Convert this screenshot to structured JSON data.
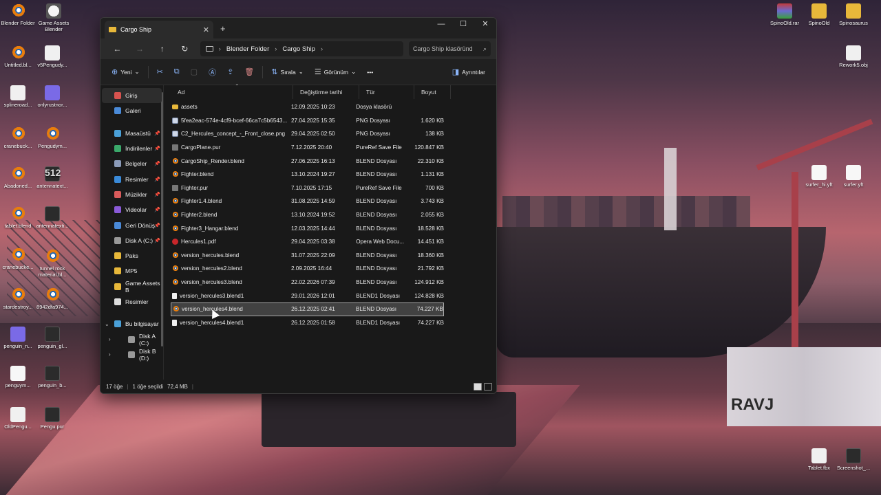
{
  "desktop": {
    "left_icons": [
      {
        "label": "Blender Folder",
        "icon": "blender-icon"
      },
      {
        "label": "Game Assets Blender",
        "icon": "game-icon"
      },
      {
        "label": "Untitled.bl...",
        "icon": "blender-icon"
      },
      {
        "label": "v5Pengudy...",
        "icon": "obj-icon"
      },
      {
        "label": "splineroad...",
        "icon": "obj-icon"
      },
      {
        "label": "onlyrustnor...",
        "icon": "purple-app-icon"
      },
      {
        "label": "cranebuck...",
        "icon": "blender-icon"
      },
      {
        "label": "Pengudym...",
        "icon": "blender-icon"
      },
      {
        "label": "Abadoned...",
        "icon": "blender-icon"
      },
      {
        "label": "antennatext...",
        "icon": "image-icon"
      },
      {
        "label": "tablet.blend",
        "icon": "blender-icon"
      },
      {
        "label": "antennatexti...",
        "icon": "image-icon"
      },
      {
        "label": "cranebucke...",
        "icon": "blender-icon"
      },
      {
        "label": "tunnel rock material.bl...",
        "icon": "blender-icon"
      },
      {
        "label": "stardestroy...",
        "icon": "blender-icon"
      },
      {
        "label": "8942dfa974...",
        "icon": "blender-icon"
      },
      {
        "label": "penguin_n...",
        "icon": "purple-app-icon"
      },
      {
        "label": "penguin_gl...",
        "icon": "image-icon"
      },
      {
        "label": "penguym...",
        "icon": "white-file-icon"
      },
      {
        "label": "penguin_b...",
        "icon": "image-icon"
      },
      {
        "label": "OldPengu...",
        "icon": "obj-icon"
      },
      {
        "label": "Pengu.pur",
        "icon": "pur-icon"
      }
    ],
    "right_icons": [
      {
        "label": "SpinoOld.rar",
        "icon": "rar-icon"
      },
      {
        "label": "SpinoOld",
        "icon": "folder-icon"
      },
      {
        "label": "Spinosaurus",
        "icon": "folder-icon"
      },
      {
        "label": "Rework5.obj",
        "icon": "obj-icon"
      },
      {
        "label": "surfer_hi.yft",
        "icon": "white-file-icon"
      },
      {
        "label": "surfer.yft",
        "icon": "white-file-icon"
      },
      {
        "label": "Tablet.fbx",
        "icon": "obj-icon"
      },
      {
        "label": "Screenshot_...",
        "icon": "image-icon"
      }
    ],
    "icon_512_label": "512"
  },
  "window": {
    "tab_title": "Cargo Ship",
    "tab_close": "✕",
    "new_tab": "+",
    "controls": {
      "minimize": "—",
      "maximize": "☐",
      "close": "✕"
    },
    "nav": {
      "back": "←",
      "forward": "→",
      "up": "↑",
      "refresh": "↻"
    },
    "breadcrumb": [
      "Blender Folder",
      "Cargo Ship"
    ],
    "crumb_sep": "›",
    "search_placeholder": "Cargo Ship klasöründ",
    "toolbar": {
      "new": "Yeni",
      "sort": "Sırala",
      "view": "Görünüm",
      "more": "•••",
      "details": "Ayrıntılar"
    },
    "sidebar": [
      {
        "label": "Giriş",
        "color": "#d8534f",
        "active": true
      },
      {
        "label": "Galeri",
        "color": "#4a8ad8"
      },
      {
        "gap": true
      },
      {
        "label": "Masaüstü",
        "color": "#4aa0d8",
        "pin": true
      },
      {
        "label": "İndirilenler",
        "color": "#3aa86a",
        "pin": true
      },
      {
        "label": "Belgeler",
        "color": "#8a9ab8",
        "pin": true
      },
      {
        "label": "Resimler",
        "color": "#3a8ad8",
        "pin": true
      },
      {
        "label": "Müzikler",
        "color": "#d85a5a",
        "pin": true
      },
      {
        "label": "Videolar",
        "color": "#8a5ad8",
        "pin": true
      },
      {
        "label": "Geri Dönüş",
        "color": "#4a8ad8",
        "pin": true
      },
      {
        "label": "Disk A (C:)",
        "color": "#999",
        "pin": true
      },
      {
        "label": "Paks",
        "color": "#e8b83a"
      },
      {
        "label": "MP5",
        "color": "#e8b83a"
      },
      {
        "label": "Game Assets B",
        "color": "#e8b83a"
      },
      {
        "label": "Resimler",
        "color": "#dddddd"
      },
      {
        "gap": true
      },
      {
        "label": "Bu bilgisayar",
        "color": "#4aa0d8",
        "chev": "⌄"
      },
      {
        "label": "Disk A (C:)",
        "color": "#999",
        "chev": "›",
        "indent": true
      },
      {
        "label": "Disk B (D:)",
        "color": "#999",
        "chev": "›",
        "indent": true
      }
    ],
    "columns": {
      "name": "Ad",
      "date": "Değiştirme tarihi",
      "type": "Tür",
      "size": "Boyut"
    },
    "files": [
      {
        "name": "assets",
        "date": "12.09.2025 10:23",
        "type": "Dosya klasörü",
        "size": "",
        "kind": "folder"
      },
      {
        "name": "5fea2eac-574e-4cf9-bcef-66ca7c5b6543...",
        "date": "27.04.2025 15:35",
        "type": "PNG Dosyası",
        "size": "1.620 KB",
        "kind": "png"
      },
      {
        "name": "C2_Hercules_concept_-_Front_close.png",
        "date": "29.04.2025 02:50",
        "type": "PNG Dosyası",
        "size": "138 KB",
        "kind": "png"
      },
      {
        "name": "CargoPlane.pur",
        "date": "7.12.2025 20:40",
        "type": "PureRef Save File",
        "size": "120.847 KB",
        "kind": "pur"
      },
      {
        "name": "CargoShip_Render.blend",
        "date": "27.06.2025 16:13",
        "type": "BLEND Dosyası",
        "size": "22.310 KB",
        "kind": "blend"
      },
      {
        "name": "Fighter.blend",
        "date": "13.10.2024 19:27",
        "type": "BLEND Dosyası",
        "size": "1.131 KB",
        "kind": "blend"
      },
      {
        "name": "Fighter.pur",
        "date": "7.10.2025 17:15",
        "type": "PureRef Save File",
        "size": "700 KB",
        "kind": "pur"
      },
      {
        "name": "Fighter1.4.blend",
        "date": "31.08.2025 14:59",
        "type": "BLEND Dosyası",
        "size": "3.743 KB",
        "kind": "blend"
      },
      {
        "name": "Fighter2.blend",
        "date": "13.10.2024 19:52",
        "type": "BLEND Dosyası",
        "size": "2.055 KB",
        "kind": "blend"
      },
      {
        "name": "Fighter3_Hangar.blend",
        "date": "12.03.2025 14:44",
        "type": "BLEND Dosyası",
        "size": "18.528 KB",
        "kind": "blend"
      },
      {
        "name": "Hercules1.pdf",
        "date": "29.04.2025 03:38",
        "type": "Opera Web Docu...",
        "size": "14.451 KB",
        "kind": "pdf"
      },
      {
        "name": "version_hercules.blend",
        "date": "31.07.2025 22:09",
        "type": "BLEND Dosyası",
        "size": "18.360 KB",
        "kind": "blend"
      },
      {
        "name": "version_hercules2.blend",
        "date": "2.09.2025 16:44",
        "type": "BLEND Dosyası",
        "size": "21.792 KB",
        "kind": "blend"
      },
      {
        "name": "version_hercules3.blend",
        "date": "22.02.2026 07:39",
        "type": "BLEND Dosyası",
        "size": "124.912 KB",
        "kind": "blend"
      },
      {
        "name": "version_hercules3.blend1",
        "date": "29.01.2026 12:01",
        "type": "BLEND1 Dosyası",
        "size": "124.828 KB",
        "kind": "blend1"
      },
      {
        "name": "version_hercules4.blend",
        "date": "26.12.2025 02:41",
        "type": "BLEND Dosyası",
        "size": "74.227 KB",
        "kind": "blend",
        "selected": true
      },
      {
        "name": "version_hercules4.blend1",
        "date": "26.12.2025 01:58",
        "type": "BLEND1 Dosyası",
        "size": "74.227 KB",
        "kind": "blend1"
      }
    ],
    "status": {
      "count": "17 öğe",
      "selected": "1 öğe seçildi",
      "size": "72,4 MB"
    }
  },
  "wallpaper": {
    "trailer_text": "RAVJ"
  }
}
